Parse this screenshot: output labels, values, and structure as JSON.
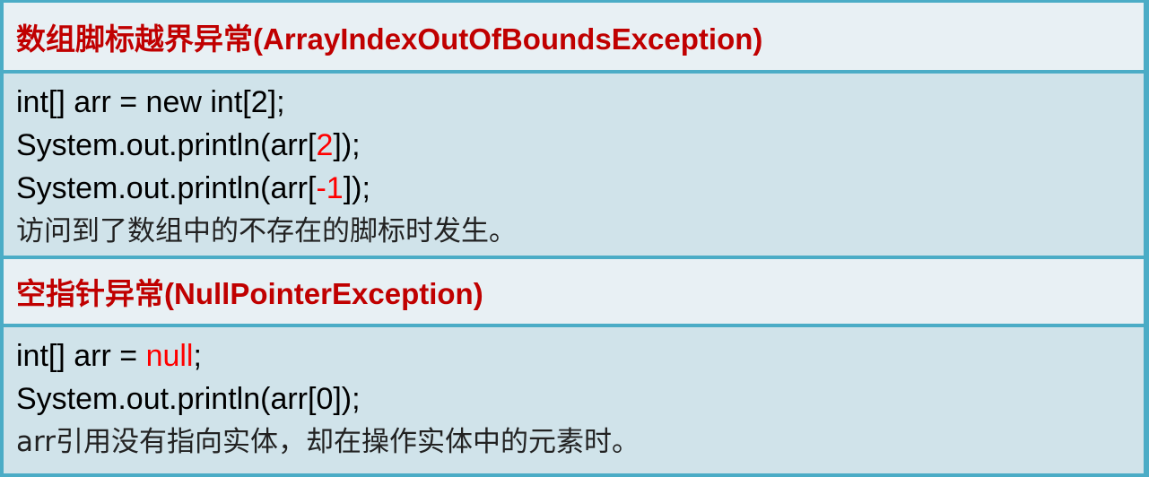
{
  "sections": [
    {
      "title": "数组脚标越界异常(ArrayIndexOutOfBoundsException)",
      "lines": [
        {
          "pre": "int[] arr = new int[2];",
          "hl": "",
          "post": ""
        },
        {
          "pre": "System.out.println(arr[",
          "hl": "2",
          "post": "]);"
        },
        {
          "pre": "System.out.println(arr[",
          "hl": "-1",
          "post": "]);"
        }
      ],
      "note": "访问到了数组中的不存在的脚标时发生。"
    },
    {
      "title": "空指针异常(NullPointerException)",
      "lines": [
        {
          "pre": "int[] arr = ",
          "hl": "null",
          "post": ";"
        },
        {
          "pre": "System.out.println(arr[0]);",
          "hl": "",
          "post": ""
        }
      ],
      "note": "arr引用没有指向实体，却在操作实体中的元素时。"
    }
  ],
  "colors": {
    "border": "#4bacc6",
    "title": "#c00000",
    "highlight": "#ff0000"
  }
}
